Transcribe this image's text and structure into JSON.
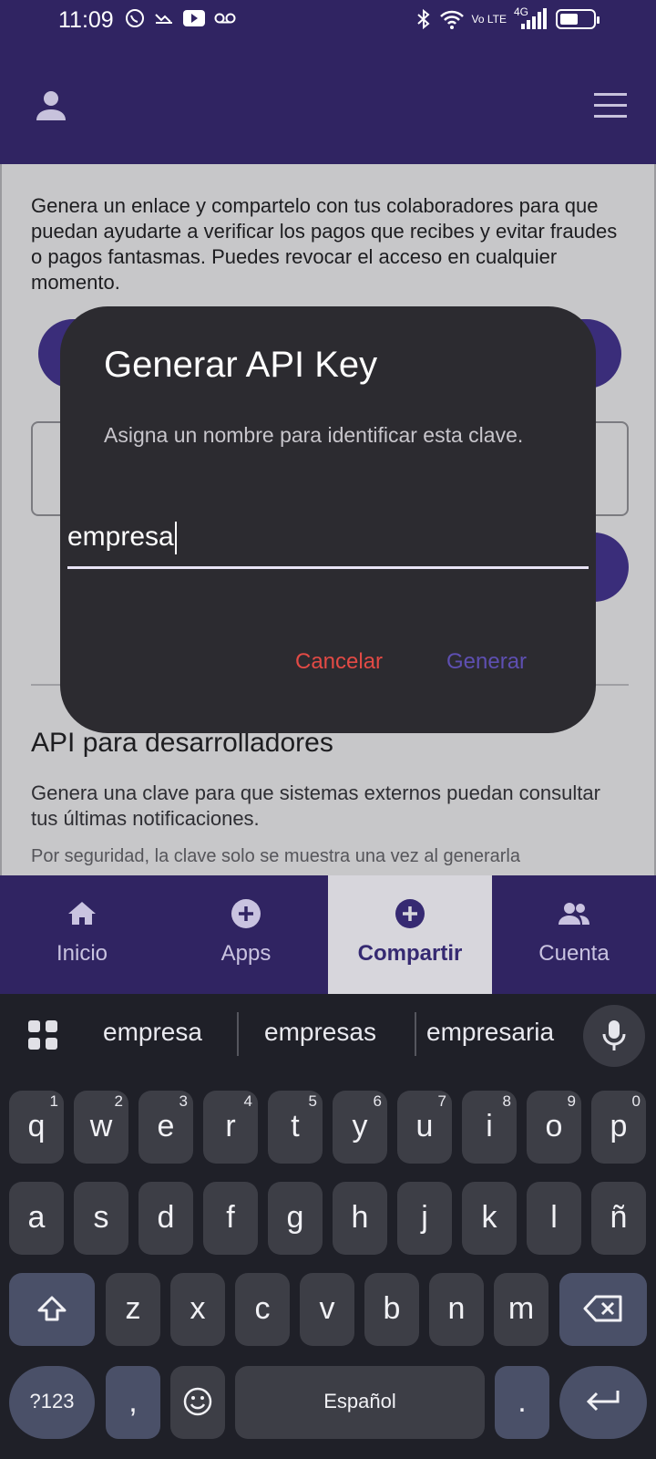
{
  "status_bar": {
    "time": "11:09",
    "lte_label": "Vo LTE",
    "network_label": "4G",
    "battery_level": 0.55
  },
  "content": {
    "intro_text": "Genera un enlace y compartelo con tus colaboradores para que puedan ayudarte a verificar los pagos que recibes y evitar fraudes o pagos fantasmas. Puedes revocar el acceso en cualquier momento.",
    "api_title": "API para desarrolladores",
    "api_description": "Genera una clave para que sistemas externos puedan consultar tus últimas notificaciones.",
    "api_note": "Por seguridad, la clave solo se muestra una vez al generarla"
  },
  "dialog": {
    "title": "Generar API Key",
    "message": "Asigna un nombre para identificar esta clave.",
    "input_value": "empresa",
    "cancel_label": "Cancelar",
    "generate_label": "Generar"
  },
  "bottom_nav": {
    "items": [
      {
        "label": "Inicio",
        "icon": "home-icon",
        "active": false
      },
      {
        "label": "Apps",
        "icon": "plus-circle-icon",
        "active": false
      },
      {
        "label": "Compartir",
        "icon": "plus-circle-icon",
        "active": true
      },
      {
        "label": "Cuenta",
        "icon": "people-icon",
        "active": false
      }
    ]
  },
  "keyboard": {
    "suggestions": [
      "empresa",
      "empresas",
      "empresaria"
    ],
    "row1": [
      {
        "key": "q",
        "sup": "1"
      },
      {
        "key": "w",
        "sup": "2"
      },
      {
        "key": "e",
        "sup": "3"
      },
      {
        "key": "r",
        "sup": "4"
      },
      {
        "key": "t",
        "sup": "5"
      },
      {
        "key": "y",
        "sup": "6"
      },
      {
        "key": "u",
        "sup": "7"
      },
      {
        "key": "i",
        "sup": "8"
      },
      {
        "key": "o",
        "sup": "9"
      },
      {
        "key": "p",
        "sup": "0"
      }
    ],
    "row2": [
      "a",
      "s",
      "d",
      "f",
      "g",
      "h",
      "j",
      "k",
      "l",
      "ñ"
    ],
    "row3": [
      "z",
      "x",
      "c",
      "v",
      "b",
      "n",
      "m"
    ],
    "symbols_label": "?123",
    "comma_label": ",",
    "space_label": "Español",
    "period_label": "."
  },
  "colors": {
    "brand_purple": "#302462",
    "cancel_red": "#e24a45",
    "generate_purple": "#5e4fb1"
  }
}
